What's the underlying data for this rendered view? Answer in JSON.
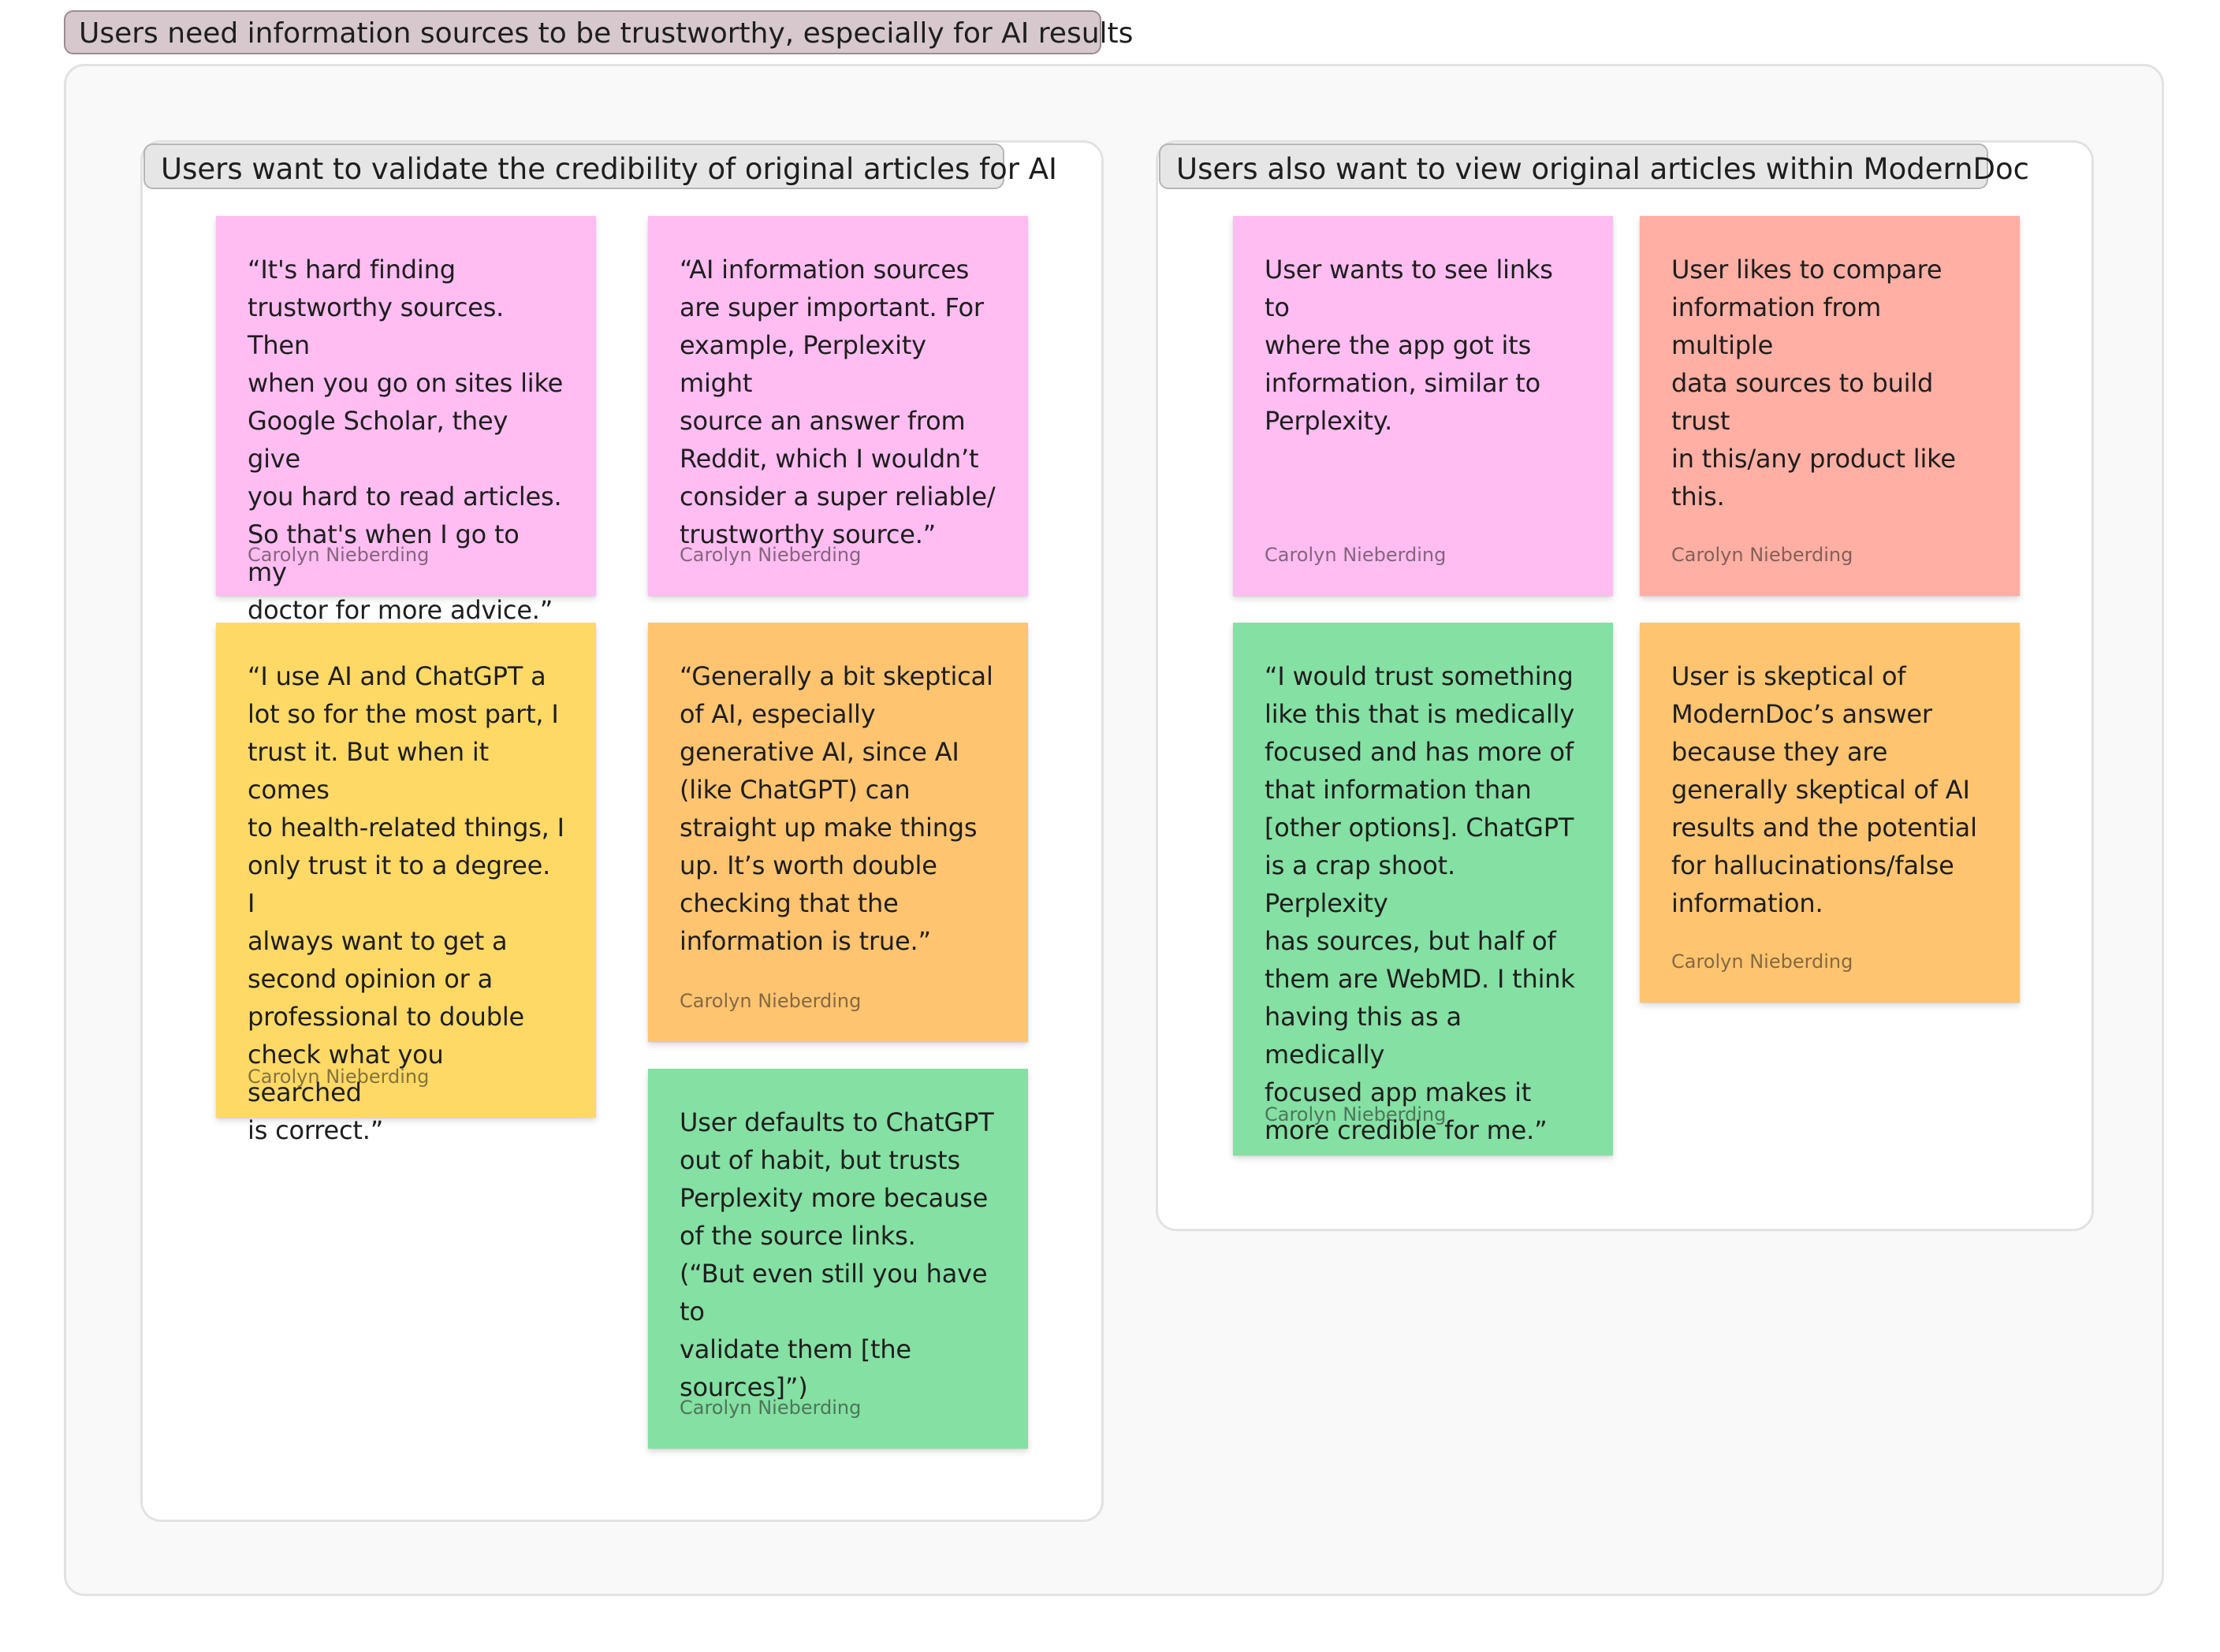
{
  "board": {
    "title": "Users need information sources to be trustworthy, especially for AI results"
  },
  "sections": [
    {
      "label": "Users want to validate the credibility of original articles for AI",
      "notes": [
        {
          "text": "“It's hard finding\ntrustworthy sources. Then\nwhen you go on sites like\nGoogle Scholar, they give\nyou hard to read articles.\nSo that's when I go to my\ndoctor for more advice.”",
          "author": "Carolyn Nieberding",
          "color": "#ffbdf2"
        },
        {
          "text": "“AI information sources\nare super important. For\nexample, Perplexity might\nsource an answer from\nReddit, which I wouldn’t\nconsider a super reliable/\ntrustworthy source.”",
          "author": "Carolyn Nieberding",
          "color": "#ffbdf2"
        },
        {
          "text": "“I use AI and ChatGPT a\nlot so for the most part, I\ntrust it. But when it comes\nto health-related things, I\nonly trust it to  a degree. I\nalways want to get a\nsecond opinion or a\nprofessional to double\ncheck what you searched\nis correct.”",
          "author": "Carolyn Nieberding",
          "color": "#ffd966"
        },
        {
          "text": "“Generally a bit skeptical\nof AI, especially\ngenerative AI, since AI\n(like ChatGPT) can\nstraight up make things\nup. It’s worth double\nchecking that the\ninformation is true.”",
          "author": "Carolyn Nieberding",
          "color": "#ffc470"
        },
        {
          "text": "User defaults to ChatGPT\nout of habit, but trusts\nPerplexity more because\nof the source links.\n(“But even still you have to\nvalidate them [the\nsources]”)",
          "author": "Carolyn Nieberding",
          "color": "#85e0a3"
        }
      ]
    },
    {
      "label": "Users also want to view original articles within ModernDoc",
      "notes": [
        {
          "text": "User wants to see links to\nwhere the app got its\ninformation, similar to\nPerplexity.",
          "author": "Carolyn Nieberding",
          "color": "#ffbdf2"
        },
        {
          "text": "User likes to compare\ninformation from multiple\ndata sources to build trust\nin this/any product like\nthis.",
          "author": "Carolyn Nieberding",
          "color": "#ffafa3"
        },
        {
          "text": "“I would trust something\nlike this that is medically\nfocused and has more of\nthat information than\n[other options]. ChatGPT\nis a crap shoot. Perplexity\nhas sources, but half of\nthem are WebMD. I think\nhaving this as a medically\nfocused app makes it\nmore credible for me.”",
          "author": "Carolyn Nieberding",
          "color": "#85e0a3"
        },
        {
          "text": "User is skeptical of\nModernDoc’s answer\nbecause they are\ngenerally skeptical of AI\nresults and the potential\nfor hallucinations/false\ninformation.",
          "author": "Carolyn Nieberding",
          "color": "#ffc470"
        }
      ]
    }
  ]
}
